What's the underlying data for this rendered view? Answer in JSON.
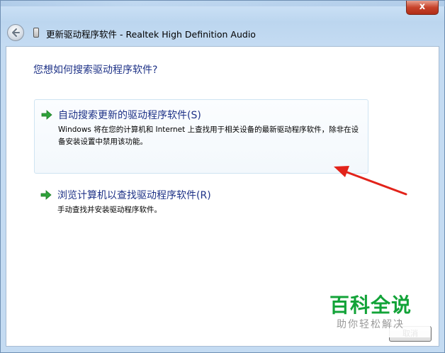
{
  "window": {
    "title": "更新驱动程序软件 - Realtek High Definition Audio",
    "close_glyph": "x"
  },
  "main": {
    "question": "您想如何搜索驱动程序软件?",
    "options": [
      {
        "title": "自动搜索更新的驱动程序软件(S)",
        "description": "Windows 将在您的计算机和 Internet 上查找用于相关设备的最新驱动程序软件，除非在设备安装设置中禁用该功能。"
      },
      {
        "title": "浏览计算机以查找驱动程序软件(R)",
        "description": "手动查找并安装驱动程序软件。"
      }
    ]
  },
  "footer": {
    "cancel_label": "取消"
  },
  "watermark": {
    "title": "百科全说",
    "subtitle": "助你轻松解决"
  },
  "colors": {
    "link_blue": "#1e3287",
    "arrow_green": "#2fa33a",
    "annotation_red": "#e2231a",
    "watermark_green": "#12a338"
  },
  "icons": {
    "back": "back-arrow-icon",
    "option_arrow": "green-arrow-icon",
    "device": "device-icon"
  }
}
